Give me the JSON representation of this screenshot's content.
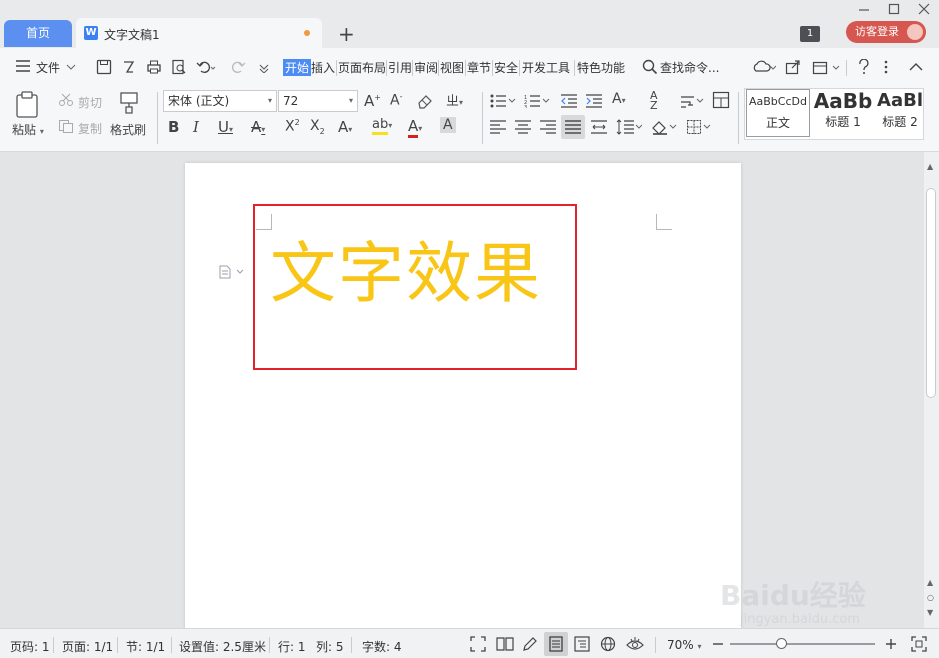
{
  "titlebar": {
    "home_tab": "首页",
    "doc_tab": "文字文稿1",
    "doc_icon_letter": "W",
    "new_tab_glyph": "+",
    "badge_count": "1",
    "visitor_login": "访客登录"
  },
  "menu": {
    "file": "文件",
    "tabs": [
      "开始",
      "插入",
      "页面布局",
      "引用",
      "审阅",
      "视图",
      "章节",
      "安全",
      "开发工具",
      "特色功能"
    ],
    "search_label": "查找命令..."
  },
  "toolbar": {
    "paste": "粘贴",
    "cut": "剪切",
    "copy": "复制",
    "format_painter": "格式刷",
    "font_name": "宋体 (正文)",
    "font_size": "72",
    "styles": [
      {
        "preview": "AaBbCcDd",
        "name": "正文"
      },
      {
        "preview": "AaBb",
        "name": "标题 1"
      },
      {
        "preview": "AaBl",
        "name": "标题 2"
      }
    ]
  },
  "document": {
    "heading": "文字效果",
    "heading_color": "#f9c516",
    "highlight_color": "#e3232b"
  },
  "status": {
    "page_num": "页码: 1",
    "pages": "页面: 1/1",
    "section": "节: 1/1",
    "setting": "设置值: 2.5厘米",
    "row": "行: 1",
    "col": "列: 5",
    "words": "字数: 4",
    "zoom": "70%"
  },
  "watermark": {
    "brand": "Baidu经验",
    "url": "jingyan.baidu.com"
  }
}
